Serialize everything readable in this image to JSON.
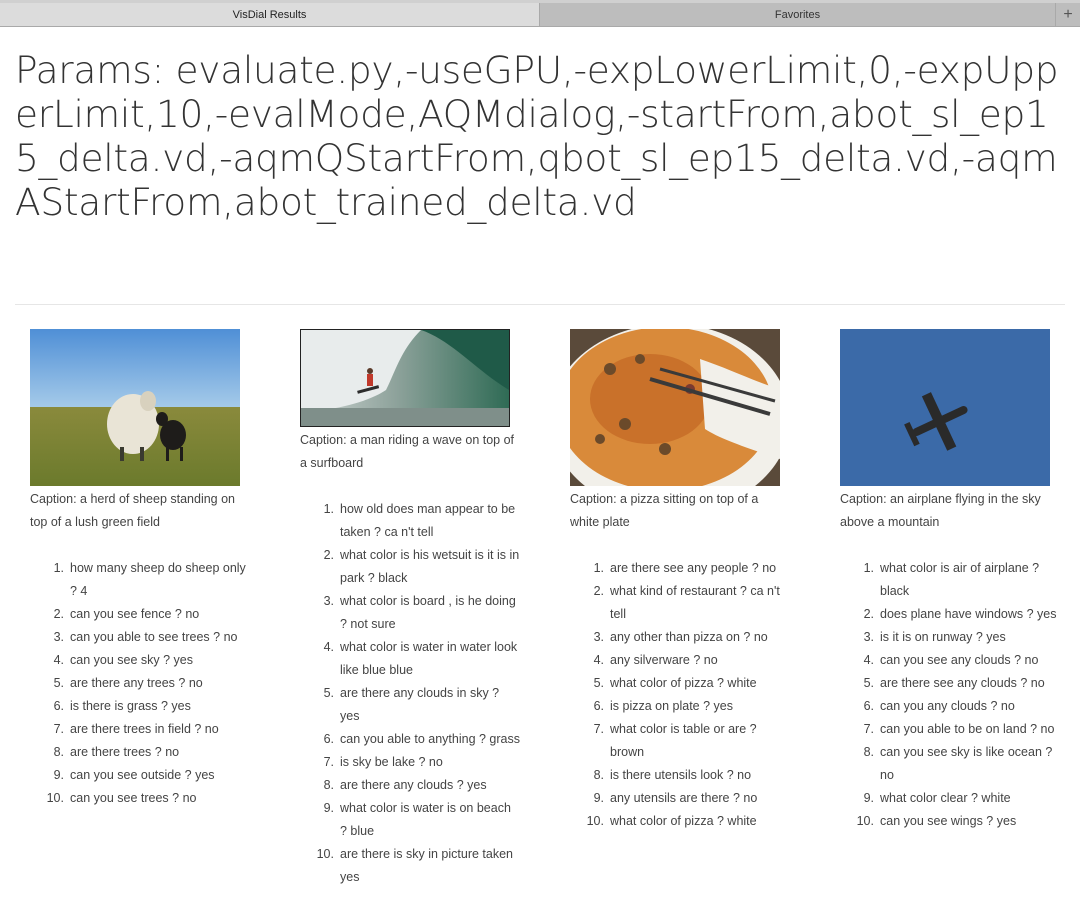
{
  "tabs": [
    {
      "label": "VisDial Results"
    },
    {
      "label": "Favorites"
    }
  ],
  "add_tab_label": "+",
  "params_title": "Params: evaluate.py,-useGPU,-expLowerLimit,0,-expUpperLimit,10,-evalMode,AQMdialog,-startFrom,abot_sl_ep15_delta.vd,-aqmQStartFrom,qbot_sl_ep15_delta.vd,-aqmAStartFrom,abot_trained_delta.vd",
  "results": [
    {
      "image": "sheep-photo",
      "caption": "Caption: a herd of sheep standing on top of a lush green field",
      "qa": [
        {
          "n": "1.",
          "text": "how many sheep do sheep only ? 4"
        },
        {
          "n": "2.",
          "text": "can you see fence ? no"
        },
        {
          "n": "3.",
          "text": "can you able to see trees ? no"
        },
        {
          "n": "4.",
          "text": "can you see sky ? yes"
        },
        {
          "n": "5.",
          "text": "are there any trees ? no"
        },
        {
          "n": "6.",
          "text": "is there is grass ? yes"
        },
        {
          "n": "7.",
          "text": "are there trees in field ? no"
        },
        {
          "n": "8.",
          "text": "are there trees ? no"
        },
        {
          "n": "9.",
          "text": "can you see outside ? yes"
        },
        {
          "n": "10.",
          "text": "can you see trees ? no"
        }
      ]
    },
    {
      "image": "surfer-photo",
      "caption": "Caption: a man riding a wave on top of a surfboard",
      "qa": [
        {
          "n": "1.",
          "text": "how old does man appear to be taken ? ca n't tell"
        },
        {
          "n": "2.",
          "text": "what color is his wetsuit is it is in park ? black"
        },
        {
          "n": "3.",
          "text": "what color is board , is he doing ? not sure"
        },
        {
          "n": "4.",
          "text": "what color is water in water look like blue blue"
        },
        {
          "n": "5.",
          "text": "are there any clouds in sky ? yes"
        },
        {
          "n": "6.",
          "text": "can you able to anything ? grass"
        },
        {
          "n": "7.",
          "text": "is sky be lake ? no"
        },
        {
          "n": "8.",
          "text": "are there any clouds ? yes"
        },
        {
          "n": "9.",
          "text": "what color is water is on beach ? blue"
        },
        {
          "n": "10.",
          "text": "are there is sky in picture taken yes"
        }
      ]
    },
    {
      "image": "pizza-photo",
      "caption": "Caption: a pizza sitting on top of a white plate",
      "qa": [
        {
          "n": "1.",
          "text": "are there see any people ? no"
        },
        {
          "n": "2.",
          "text": "what kind of restaurant ? ca n't tell"
        },
        {
          "n": "3.",
          "text": "any other than pizza on ? no"
        },
        {
          "n": "4.",
          "text": "any silverware ? no"
        },
        {
          "n": "5.",
          "text": "what color of pizza ? white"
        },
        {
          "n": "6.",
          "text": "is pizza on plate ? yes"
        },
        {
          "n": "7.",
          "text": "what color is table or are ? brown"
        },
        {
          "n": "8.",
          "text": "is there utensils look ? no"
        },
        {
          "n": "9.",
          "text": "any utensils are there ? no"
        },
        {
          "n": "10.",
          "text": "what color of pizza ? white"
        }
      ]
    },
    {
      "image": "airplane-photo",
      "caption": "Caption: an airplane flying in the sky above a mountain",
      "qa": [
        {
          "n": "1.",
          "text": "what color is air of airplane ? black"
        },
        {
          "n": "2.",
          "text": "does plane have windows ? yes"
        },
        {
          "n": "3.",
          "text": "is it is on runway ? yes"
        },
        {
          "n": "4.",
          "text": "can you see any clouds ? no"
        },
        {
          "n": "5.",
          "text": "are there see any clouds ? no"
        },
        {
          "n": "6.",
          "text": "can you any clouds ? no"
        },
        {
          "n": "7.",
          "text": "can you able to be on land ? no"
        },
        {
          "n": "8.",
          "text": "can you see sky is like ocean ? no"
        },
        {
          "n": "9.",
          "text": "what color clear ? white"
        },
        {
          "n": "10.",
          "text": "can you see wings ? yes"
        }
      ]
    }
  ]
}
